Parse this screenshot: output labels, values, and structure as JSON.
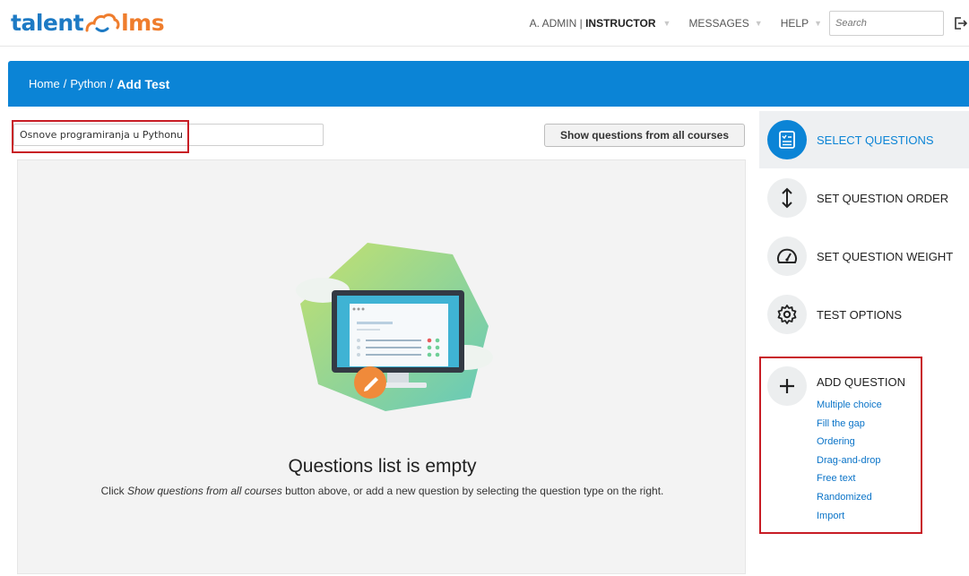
{
  "brand": {
    "logo_left": "talent",
    "logo_right": "lms",
    "logo_icon": "cloud-icon"
  },
  "header": {
    "user_name": "A. ADMIN",
    "user_separator": " | ",
    "user_role": "INSTRUCTOR",
    "messages_label": "MESSAGES",
    "help_label": "HELP",
    "caret": "▼",
    "search_placeholder": "Search",
    "logout_icon": "logout-icon"
  },
  "breadcrumb": {
    "home": "Home",
    "separator": "/",
    "course": "Python",
    "current": "Add Test"
  },
  "main": {
    "course_select_value": "Osnove programiranja u Pythonu",
    "show_all_button": "Show questions from all courses",
    "empty_title": "Questions list is empty",
    "empty_desc_prefix": "Click ",
    "empty_desc_emphasis": "Show questions from all courses",
    "empty_desc_suffix": " button above, or add a new question by selecting the question type on the right."
  },
  "sidebar": {
    "steps": [
      {
        "label": "SELECT QUESTIONS",
        "icon": "checklist-icon",
        "active": true
      },
      {
        "label": "SET QUESTION ORDER",
        "icon": "vertical-arrows-icon",
        "active": false
      },
      {
        "label": "SET QUESTION WEIGHT",
        "icon": "gauge-icon",
        "active": false
      },
      {
        "label": "TEST OPTIONS",
        "icon": "gear-icon",
        "active": false
      }
    ],
    "add_question": {
      "title": "ADD QUESTION",
      "icon": "plus-icon",
      "types": [
        "Multiple choice",
        "Fill the gap",
        "Ordering",
        "Drag-and-drop",
        "Free text",
        "Randomized",
        "Import"
      ]
    }
  },
  "colors": {
    "primary_blue": "#0b84d6",
    "highlight_red": "#c81d25",
    "logo_blue": "#1d7ac4",
    "logo_orange": "#ef7d2d",
    "empty_bg": "#f3f3f3"
  }
}
